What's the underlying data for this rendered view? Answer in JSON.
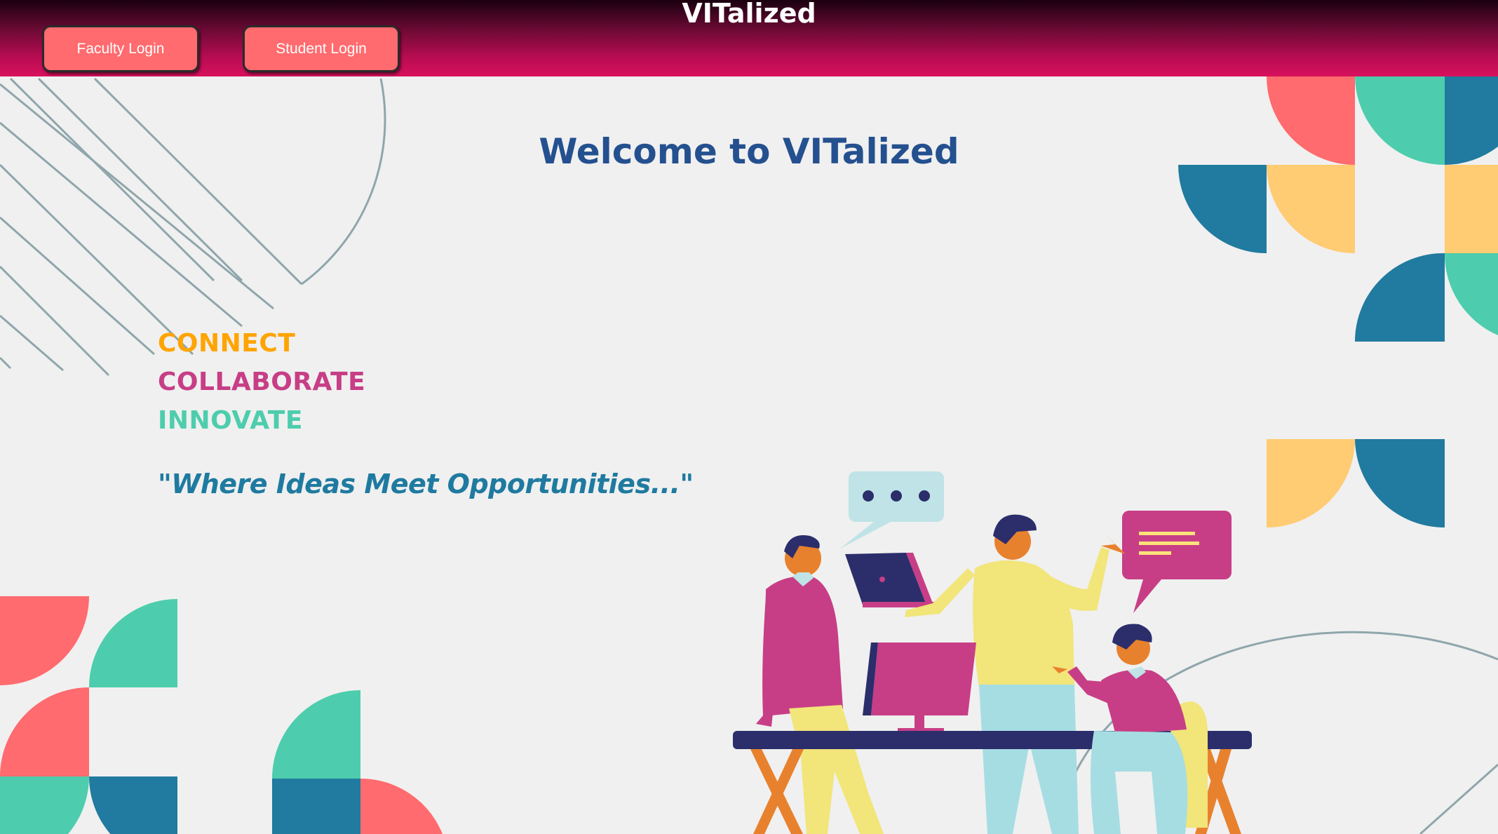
{
  "header": {
    "brand": "VITalized",
    "faculty_login_label": "Faculty Login",
    "student_login_label": "Student Login"
  },
  "main": {
    "welcome": "Welcome to VITalized",
    "taglines": [
      "CONNECT",
      "COLLABORATE",
      "INNOVATE"
    ],
    "quote": "\"Where Ideas Meet Opportunities...\""
  },
  "colors": {
    "coral": "#ff6b6e",
    "teal": "#4dcdad",
    "blue": "#217a9f",
    "yellow": "#ffcb73",
    "magenta": "#c73e86",
    "navy": "#24508f",
    "header_top": "#1a0010",
    "header_bottom": "#d8105d"
  },
  "illustration": {
    "icon": "team-collaboration-illustration"
  }
}
